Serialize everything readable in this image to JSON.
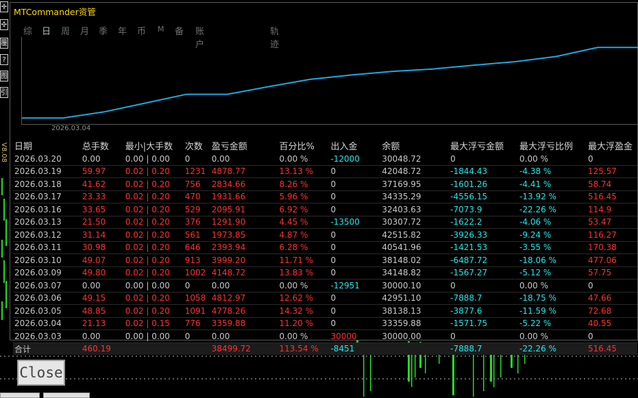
{
  "window": {
    "title": "MTCommander资管"
  },
  "left_tools": {
    "icons": [
      "✛",
      "✣",
      "覆",
      "?",
      "图",
      "引"
    ],
    "version_label": "V8.08"
  },
  "tabs": [
    {
      "label": "综",
      "active": false
    },
    {
      "label": "日",
      "active": true
    },
    {
      "label": "周",
      "active": false
    },
    {
      "label": "月",
      "active": false
    },
    {
      "label": "季",
      "active": false
    },
    {
      "label": "年",
      "active": false
    },
    {
      "label": "币",
      "active": false
    },
    {
      "label": "M",
      "active": false
    },
    {
      "label": "备",
      "active": false
    },
    {
      "label": "账户",
      "active": false
    },
    {
      "label": "轨迹",
      "active": false
    }
  ],
  "equity_chart": {
    "x_tick_label": "2026.03.04",
    "line_color": "#1fa8e0",
    "points": [
      {
        "date": "2026.03.03",
        "value": 30000.0
      },
      {
        "date": "2026.03.04",
        "value": 33359.88
      },
      {
        "date": "2026.03.05",
        "value": 38138.13
      },
      {
        "date": "2026.03.06",
        "value": 42951.1
      },
      {
        "date": "2026.03.07",
        "value": 30000.1
      },
      {
        "date": "2026.03.09",
        "value": 34148.82
      },
      {
        "date": "2026.03.10",
        "value": 38148.02
      },
      {
        "date": "2026.03.11",
        "value": 40541.96
      },
      {
        "date": "2026.03.12",
        "value": 42515.82
      },
      {
        "date": "2026.03.13",
        "value": 30307.72
      },
      {
        "date": "2026.03.16",
        "value": 32403.63
      },
      {
        "date": "2026.03.17",
        "value": 34335.29
      },
      {
        "date": "2026.03.18",
        "value": 37169.95
      },
      {
        "date": "2026.03.19",
        "value": 42048.72
      },
      {
        "date": "2026.03.20",
        "value": 30048.72
      }
    ]
  },
  "table": {
    "headers": [
      "日期",
      "总手数",
      "最小|大手数",
      "次数",
      "盈亏金额",
      "百分比%",
      "出入金",
      "余额",
      "最大浮亏金额",
      "最大浮亏比例",
      "最大浮盈金"
    ],
    "rows": [
      {
        "cells": [
          "2026.03.20",
          "0.00",
          "0.00 | 0.00",
          "0",
          "0.00",
          "0.00 %",
          "-12000",
          "30048.72",
          "0",
          "0.00 %",
          "0"
        ],
        "colors": [
          "w",
          "w",
          "w",
          "w",
          "w",
          "w",
          "c",
          "w",
          "w",
          "w",
          "w"
        ]
      },
      {
        "cells": [
          "2026.03.19",
          "59.97",
          "0.02 | 0.20",
          "1231",
          "4878.77",
          "13.13 %",
          "0",
          "42048.72",
          "-1844.43",
          "-4.38 %",
          "125.57"
        ],
        "colors": [
          "w",
          "r",
          "r",
          "r",
          "r",
          "r",
          "w",
          "w",
          "c",
          "c",
          "r"
        ]
      },
      {
        "cells": [
          "2026.03.18",
          "41.62",
          "0.02 | 0.20",
          "756",
          "2834.66",
          "8.26 %",
          "0",
          "37169.95",
          "-1601.26",
          "-4.41 %",
          "58.74"
        ],
        "colors": [
          "w",
          "r",
          "r",
          "r",
          "r",
          "r",
          "w",
          "w",
          "c",
          "c",
          "r"
        ]
      },
      {
        "cells": [
          "2026.03.17",
          "23.33",
          "0.02 | 0.20",
          "470",
          "1931.66",
          "5.96 %",
          "0",
          "34335.29",
          "-4556.15",
          "-13.92 %",
          "516.45"
        ],
        "colors": [
          "w",
          "r",
          "r",
          "r",
          "r",
          "r",
          "w",
          "w",
          "c",
          "c",
          "r"
        ]
      },
      {
        "cells": [
          "2026.03.16",
          "33.65",
          "0.02 | 0.20",
          "529",
          "2095.91",
          "6.92 %",
          "0",
          "32403.63",
          "-7073.9",
          "-22.26 %",
          "114.9"
        ],
        "colors": [
          "w",
          "r",
          "r",
          "r",
          "r",
          "r",
          "w",
          "w",
          "c",
          "c",
          "r"
        ]
      },
      {
        "cells": [
          "2026.03.13",
          "21.50",
          "0.02 | 0.20",
          "376",
          "1291.90",
          "4.45 %",
          "-13500",
          "30307.72",
          "-1622.2",
          "-4.06 %",
          "53.47"
        ],
        "colors": [
          "w",
          "r",
          "r",
          "r",
          "r",
          "r",
          "c",
          "w",
          "c",
          "c",
          "r"
        ]
      },
      {
        "cells": [
          "2026.03.12",
          "31.14",
          "0.02 | 0.20",
          "561",
          "1973.85",
          "4.87 %",
          "0",
          "42515.82",
          "-3926.33",
          "-9.24 %",
          "116.27"
        ],
        "colors": [
          "w",
          "r",
          "r",
          "r",
          "r",
          "r",
          "w",
          "w",
          "c",
          "c",
          "r"
        ]
      },
      {
        "cells": [
          "2026.03.11",
          "30.98",
          "0.02 | 0.20",
          "646",
          "2393.94",
          "6.28 %",
          "0",
          "40541.96",
          "-1421.53",
          "-3.55 %",
          "170.38"
        ],
        "colors": [
          "w",
          "r",
          "r",
          "r",
          "r",
          "r",
          "w",
          "w",
          "c",
          "c",
          "r"
        ]
      },
      {
        "cells": [
          "2026.03.10",
          "49.07",
          "0.02 | 0.20",
          "913",
          "3999.20",
          "11.71 %",
          "0",
          "38148.02",
          "-6487.72",
          "-18.06 %",
          "477.06"
        ],
        "colors": [
          "w",
          "r",
          "r",
          "r",
          "r",
          "r",
          "w",
          "w",
          "c",
          "c",
          "r"
        ]
      },
      {
        "cells": [
          "2026.03.09",
          "49.80",
          "0.02 | 0.20",
          "1002",
          "4148.72",
          "13.83 %",
          "0",
          "34148.82",
          "-1567.27",
          "-5.12 %",
          "57.75"
        ],
        "colors": [
          "w",
          "r",
          "r",
          "r",
          "r",
          "r",
          "w",
          "w",
          "c",
          "c",
          "r"
        ]
      },
      {
        "cells": [
          "2026.03.07",
          "0.00",
          "0.00 | 0.00",
          "0",
          "0.00",
          "0.00 %",
          "-12951",
          "30000.10",
          "0",
          "0.00 %",
          "0"
        ],
        "colors": [
          "w",
          "w",
          "w",
          "w",
          "w",
          "w",
          "c",
          "w",
          "w",
          "w",
          "w"
        ]
      },
      {
        "cells": [
          "2026.03.06",
          "49.15",
          "0.02 | 0.20",
          "1058",
          "4812.97",
          "12.62 %",
          "0",
          "42951.10",
          "-7888.7",
          "-18.75 %",
          "47.66"
        ],
        "colors": [
          "w",
          "r",
          "r",
          "r",
          "r",
          "r",
          "w",
          "w",
          "c",
          "c",
          "r"
        ]
      },
      {
        "cells": [
          "2026.03.05",
          "48.85",
          "0.02 | 0.20",
          "1091",
          "4778.26",
          "14.32 %",
          "0",
          "38138.13",
          "-3877.6",
          "-11.59 %",
          "72.68"
        ],
        "colors": [
          "w",
          "r",
          "r",
          "r",
          "r",
          "r",
          "w",
          "w",
          "c",
          "c",
          "r"
        ]
      },
      {
        "cells": [
          "2026.03.04",
          "21.13",
          "0.02 | 0.15",
          "776",
          "3359.88",
          "11.20 %",
          "0",
          "33359.88",
          "-1571.75",
          "-5.22 %",
          "40.55"
        ],
        "colors": [
          "w",
          "r",
          "r",
          "r",
          "r",
          "r",
          "w",
          "w",
          "c",
          "c",
          "r"
        ]
      },
      {
        "cells": [
          "2026.03.03",
          "0.00",
          "0.00 | 0.00",
          "0",
          "0.00",
          "0.00 %",
          "30000",
          "30000.00",
          "0",
          "0.00 %",
          "0"
        ],
        "colors": [
          "w",
          "w",
          "w",
          "w",
          "w",
          "w",
          "r",
          "w",
          "w",
          "w",
          "w"
        ]
      }
    ],
    "total": {
      "cells": [
        "合计",
        "460.19",
        "",
        "",
        "38499.72",
        "113.54 %",
        "-8451",
        "",
        "-7888.7",
        "-22.26 %",
        "516.45"
      ],
      "colors": [
        "w",
        "r",
        "w",
        "w",
        "r",
        "r",
        "c",
        "w",
        "c",
        "c",
        "r"
      ]
    }
  },
  "close_button": {
    "label": "Close"
  },
  "colors": {
    "accent_title": "#ffd800",
    "positive": "#ff3030",
    "negative": "#20e8e8",
    "equity_line": "#1fa8e0",
    "candle": "#22dd22"
  }
}
